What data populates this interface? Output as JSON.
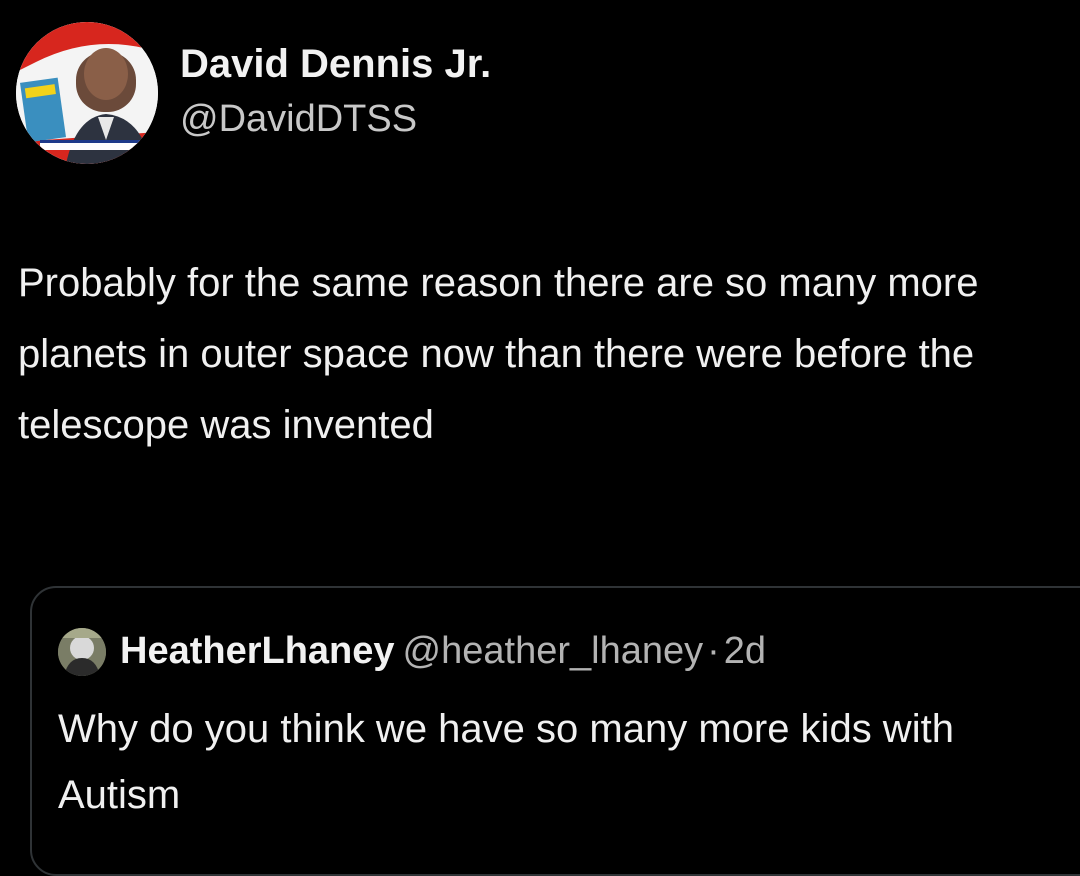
{
  "tweet": {
    "author": {
      "name": "David Dennis Jr.",
      "handle": "@DavidDTSS",
      "avatar": "profile-photo-man-holding-book"
    },
    "text": "Probably for the same reason there are so many more planets in outer space now than there were before the telescope was invented"
  },
  "quoted_tweet": {
    "author": {
      "name": "HeatherLhaney",
      "handle": "@heather_lhaney",
      "avatar": "profile-photo-small"
    },
    "separator": "·",
    "time": "2d",
    "text": "Why do you think we have so many more kids with Autism"
  },
  "colors": {
    "background": "#000000",
    "text_primary": "#f0f0f0",
    "text_secondary": "#b3b3b3",
    "card_border": "#2f3336",
    "avatar_ring": "#e0302a"
  }
}
